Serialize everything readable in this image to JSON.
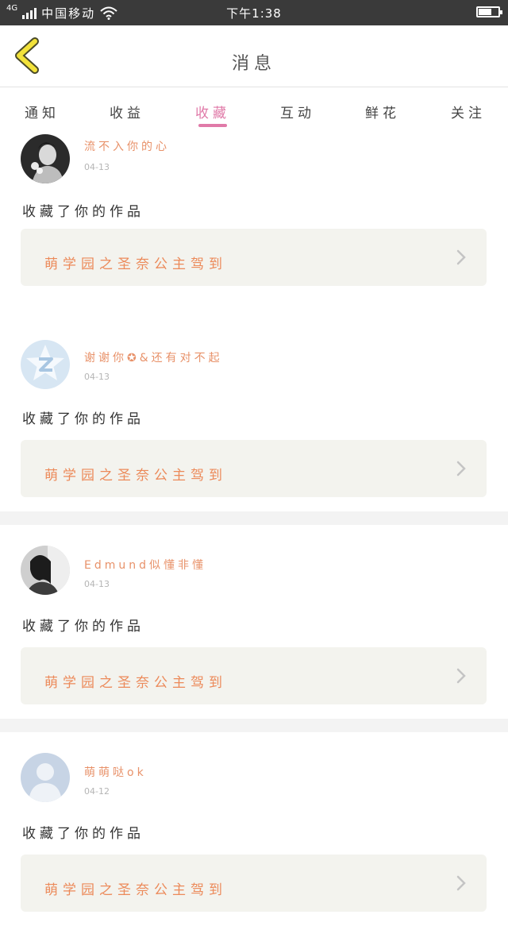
{
  "status_bar": {
    "network": "4G",
    "carrier": "中国移动",
    "time": "下午1:38",
    "icons": [
      "signal-icon",
      "wifi-icon",
      "battery-icon"
    ]
  },
  "header": {
    "title": "消息",
    "back_icon": "chevron-left-icon"
  },
  "tabs": [
    {
      "label": "通知",
      "active": false
    },
    {
      "label": "收益",
      "active": false
    },
    {
      "label": "收藏",
      "active": true
    },
    {
      "label": "互动",
      "active": false
    },
    {
      "label": "鲜花",
      "active": false
    },
    {
      "label": "关注",
      "active": false
    }
  ],
  "colors": {
    "accent": "#e07aa8",
    "username": "#e8926a",
    "work_title": "#ec8a5a",
    "status_bar": "#3a3a3a"
  },
  "notifications": [
    {
      "username": "流不入你的心",
      "date": "04-13",
      "action": "收藏了你的作品",
      "work_title": "萌学园之圣奈公主驾到"
    },
    {
      "username": "谢谢你✪&还有对不起",
      "date": "04-13",
      "action": "收藏了你的作品",
      "work_title": "萌学园之圣奈公主驾到"
    },
    {
      "username": "Edmund似懂非懂",
      "date": "04-13",
      "action": "收藏了你的作品",
      "work_title": "萌学园之圣奈公主驾到"
    },
    {
      "username": "萌萌哒ok",
      "date": "04-12",
      "action": "收藏了你的作品",
      "work_title": "萌学园之圣奈公主驾到"
    }
  ]
}
